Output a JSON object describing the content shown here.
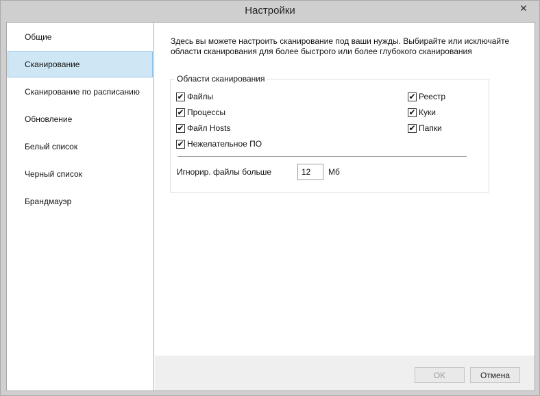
{
  "window": {
    "title": "Настройки",
    "close_glyph": "✕"
  },
  "sidebar": {
    "items": [
      {
        "label": "Общие",
        "selected": false
      },
      {
        "label": "Сканирование",
        "selected": true
      },
      {
        "label": "Сканирование по расписанию",
        "selected": false
      },
      {
        "label": "Обновление",
        "selected": false
      },
      {
        "label": "Белый список",
        "selected": false
      },
      {
        "label": "Черный список",
        "selected": false
      },
      {
        "label": "Брандмауэр",
        "selected": false
      }
    ]
  },
  "main": {
    "description_line1": "Здесь вы можете настроить сканирование под ваши нужды. Выбирайте или исключайте",
    "description_line2": "области сканирования для более быстрого или более глубокого сканирования",
    "scan_areas": {
      "legend": "Области сканирования",
      "left_column": [
        {
          "label": "Файлы",
          "checked": true
        },
        {
          "label": "Процессы",
          "checked": true
        },
        {
          "label": "Файл Hosts",
          "checked": true
        },
        {
          "label": "Нежелательное ПО",
          "checked": true
        }
      ],
      "right_column": [
        {
          "label": "Реестр",
          "checked": true
        },
        {
          "label": "Куки",
          "checked": true
        },
        {
          "label": "Папки",
          "checked": true
        }
      ],
      "check_glyph": "✔",
      "ignore_label": "Игнорир. файлы больше",
      "ignore_value": "12",
      "ignore_unit": "Мб"
    }
  },
  "footer": {
    "ok_label": "OK",
    "cancel_label": "Отмена"
  }
}
